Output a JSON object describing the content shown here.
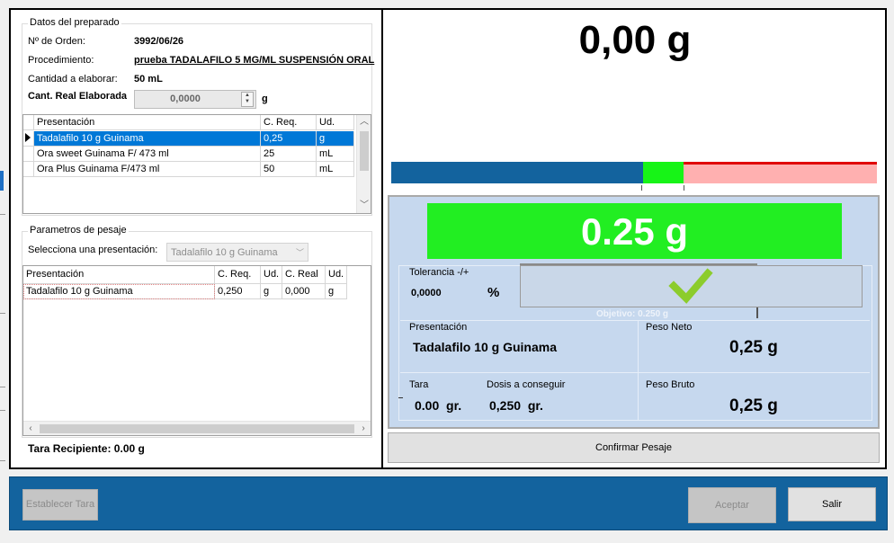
{
  "datos": {
    "title": "Datos del preparado",
    "orden_label": "Nº de Orden:",
    "orden_value": "3992/06/26",
    "procedimiento_label": "Procedimiento:",
    "procedimiento_value": "prueba TADALAFILO 5 MG/ML SUSPENSIÓN ORAL",
    "cantidad_label": "Cantidad a elaborar:",
    "cantidad_value": "50 mL",
    "cant_real_label": "Cant. Real Elaborada",
    "cant_real_value": "0,0000",
    "cant_real_unit": "g"
  },
  "presentaciones_grid": {
    "headers": [
      "Presentación",
      "C. Req.",
      "Ud."
    ],
    "rows": [
      {
        "nombre": "Tadalafilo 10 g Guinama",
        "creq": "0,25",
        "ud": "g",
        "selected": true
      },
      {
        "nombre": "Ora sweet Guinama F/ 473 ml",
        "creq": "25",
        "ud": "mL",
        "selected": false
      },
      {
        "nombre": "Ora Plus Guinama F/473 ml",
        "creq": "50",
        "ud": "mL",
        "selected": false
      }
    ]
  },
  "parametros": {
    "title": "Parametros de pesaje",
    "select_label": "Selecciona una presentación:",
    "select_value": "Tadalafilo 10 g Guinama",
    "headers": [
      "Presentación",
      "C. Req.",
      "Ud.",
      "C. Real",
      "Ud."
    ],
    "rows": [
      {
        "nombre": "Tadalafilo 10 g Guinama",
        "creq": "0,250",
        "ud": "g",
        "creal": "0,000",
        "ud2": "g"
      }
    ]
  },
  "tara_recipiente": "Tara Recipiente:  0.00 g",
  "scale": {
    "weight_display": "0,00 g",
    "target_display": "0.25 g",
    "tolerancia_label": "Tolerancia -/+",
    "tolerancia_value": "0,0000",
    "tolerancia_unit": "%",
    "objetivo_label": "Objetivo: 0.250 g",
    "presentacion_label": "Presentación",
    "presentacion_value": "Tadalafilo 10 g Guinama",
    "peso_neto_label": "Peso Neto",
    "peso_neto_value": "0,25 g",
    "tara_label": "Tara",
    "tara_value": "0.00  gr.",
    "dosis_label": "Dosis a conseguir",
    "dosis_value": "0,250  gr.",
    "peso_bruto_label": "Peso Bruto",
    "peso_bruto_value": "0,25 g",
    "confirm_label": "Confirmar Pesaje"
  },
  "bottom": {
    "tara_btn": "Establecer Tara",
    "aceptar_btn": "Aceptar",
    "salir_btn": "Salir"
  },
  "colors": {
    "accent_blue": "#13639e",
    "tolerance_green": "#17f417",
    "over_red": "#ffb0b0",
    "selection": "#0078d7"
  },
  "icons": [
    "check-icon",
    "row-pointer-icon",
    "chevron-down-icon",
    "scroll-up-icon",
    "scroll-down-icon",
    "scroll-left-icon",
    "scroll-right-icon"
  ]
}
